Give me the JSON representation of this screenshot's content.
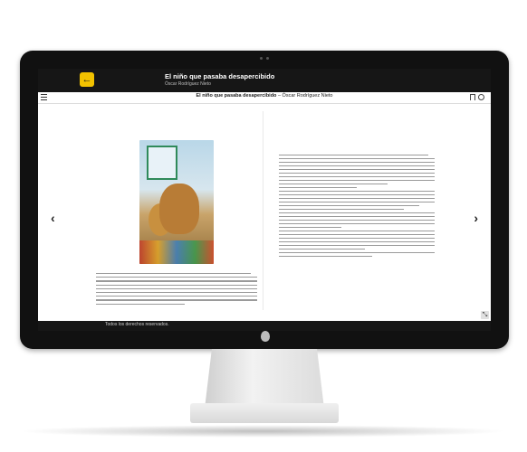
{
  "app": {
    "title": "El niño que pasaba desapercibido",
    "author": "Óscar Rodríguez Nieto",
    "back_icon": "arrow-left-icon",
    "accent": "#f2c200"
  },
  "toolbar": {
    "book_title": "El niño que pasaba desapercibido",
    "separator": "–",
    "book_author": "Óscar Rodríguez Nieto",
    "menu_icon": "hamburger-menu-icon",
    "bookmark_icon": "bookmark-icon",
    "settings_icon": "gear-icon"
  },
  "reader": {
    "prev_arrow": "‹",
    "next_arrow": "›",
    "expand_icon": "⤡"
  },
  "footer": {
    "text": "Todos los derechos reservados."
  }
}
